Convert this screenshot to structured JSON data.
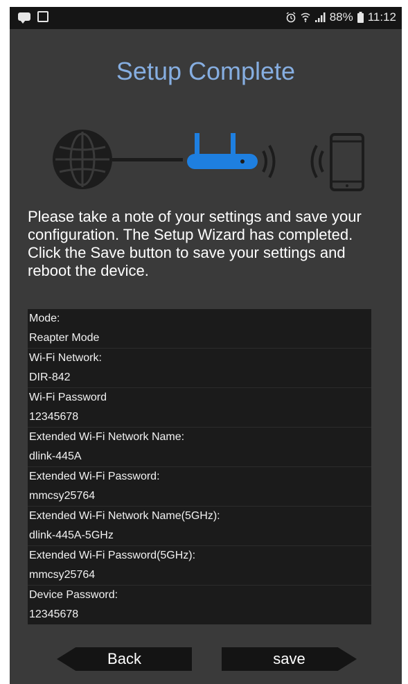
{
  "status_bar": {
    "left_icons": [
      "message-icon",
      "image-icon"
    ],
    "right_icons": [
      "alarm-icon",
      "wifi-icon",
      "signal-icon",
      "battery-icon"
    ],
    "battery": "88%",
    "time": "11:12"
  },
  "page": {
    "title": "Setup Complete",
    "description": "Please take a note of your settings and save your configuration. The Setup Wizard has completed. Click the Save button to save your settings and reboot the device."
  },
  "diagram": {
    "icons": [
      "globe-icon",
      "router-icon",
      "smartphone-icon"
    ],
    "colors": {
      "router": "#1e7fe0",
      "globe": "#1c1c1c",
      "line": "#1c1c1c"
    }
  },
  "settings": [
    {
      "label": "Mode:",
      "value": "Reapter Mode"
    },
    {
      "label": "Wi-Fi Network:",
      "value": "DIR-842"
    },
    {
      "label": "Wi-Fi Password",
      "value": "12345678"
    },
    {
      "label": "Extended Wi-Fi Network Name:",
      "value": "dlink-445A"
    },
    {
      "label": "Extended Wi-Fi Password:",
      "value": "mmcsy25764"
    },
    {
      "label": "Extended Wi-Fi Network Name(5GHz):",
      "value": "dlink-445A-5GHz"
    },
    {
      "label": "Extended Wi-Fi Password(5GHz):",
      "value": "mmcsy25764"
    },
    {
      "label": "Device Password:",
      "value": "12345678"
    }
  ],
  "buttons": {
    "back_label": "Back",
    "save_label": "save"
  },
  "colors": {
    "background": "#3a3a3a",
    "title": "#86aee1",
    "table_background": "#1b1b1b",
    "button_background": "#141414"
  }
}
